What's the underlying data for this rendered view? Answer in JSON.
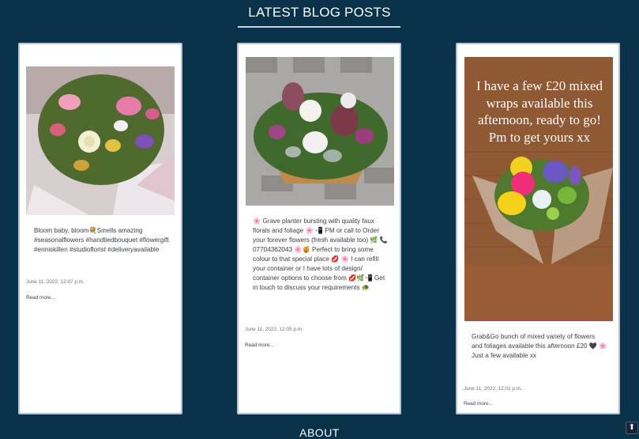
{
  "section": {
    "title": "LATEST BLOG POSTS"
  },
  "posts": [
    {
      "text": "Bloom baby, bloom💐Smells amazing #seasonalflowers #handtiedbouquet #flowergift #enniskillen #studioflorist #deliveryavailable",
      "date": "June 11, 2022, 12:07 p.m.",
      "link": "Read more..."
    },
    {
      "text": "🌸 Grave planter bursting with quality faux florals and foliage 🌸 📲 PM or call to Order your forever flowers (fresh available too) 🌿 📞07704362043 🌸🍯 Perfect to bring some colour to that special place 💋 🌸 I can refill your container or I have lots of design/ container options to choose from 💋🌿📲 Get in touch to discuss your requirements 🐢",
      "date": "June 11, 2022, 12:05 p.m.",
      "link": "Read more..."
    },
    {
      "overlay": "I have a few £20 mixed wraps available this afternoon, ready to go! Pm to get yours xx",
      "text": "Grab&Go bunch of mixed variety of flowers and foliages available this afternoon £20 🖤 🌸Just a few available xx",
      "date": "June 11, 2022, 12:01 p.m.",
      "link": "Read more..."
    }
  ],
  "footer": {
    "title": "ABOUT"
  },
  "scroll_top": {
    "icon": "arrow-up-icon",
    "glyph": "⬆"
  }
}
